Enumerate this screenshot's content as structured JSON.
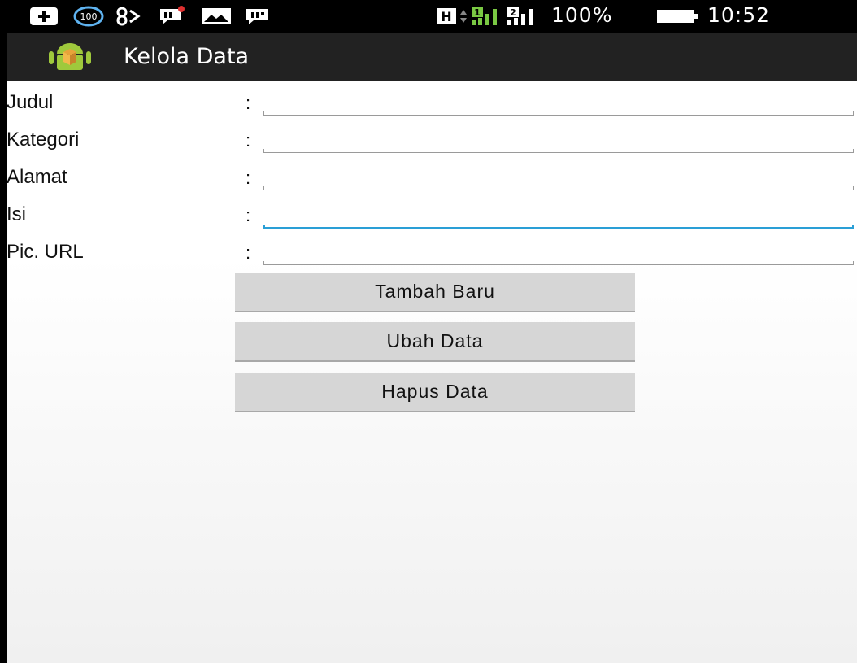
{
  "status_bar": {
    "battery_percent": "100%",
    "time": "10:52",
    "notification_badge_1": "100",
    "icons": [
      "plus-icon",
      "badge-100-icon",
      "eighty-icon",
      "bbm-icon",
      "mail-icon",
      "bbm-icon",
      "hspa-icon",
      "signal-1-icon",
      "signal-2-icon",
      "battery-icon"
    ],
    "sim1_label": "1",
    "sim2_label": "2",
    "network_label": "H"
  },
  "action_bar": {
    "title": "Kelola Data",
    "logo_icon": "android-app-icon"
  },
  "form": {
    "fields": [
      {
        "label": "Judul",
        "colon": ":",
        "value": ""
      },
      {
        "label": "Kategori",
        "colon": ":",
        "value": ""
      },
      {
        "label": "Alamat",
        "colon": ":",
        "value": ""
      },
      {
        "label": "Isi",
        "colon": ":",
        "value": ""
      },
      {
        "label": "Pic. URL",
        "colon": ":",
        "value": ""
      }
    ],
    "focused_field": "Isi"
  },
  "buttons": {
    "add": "Tambah Baru",
    "edit": "Ubah Data",
    "delete": "Hapus Data"
  },
  "colors": {
    "status_bar": "#000000",
    "action_bar": "#222222",
    "focus_accent": "#2a9fd6",
    "button_bg": "#d6d6d6"
  }
}
